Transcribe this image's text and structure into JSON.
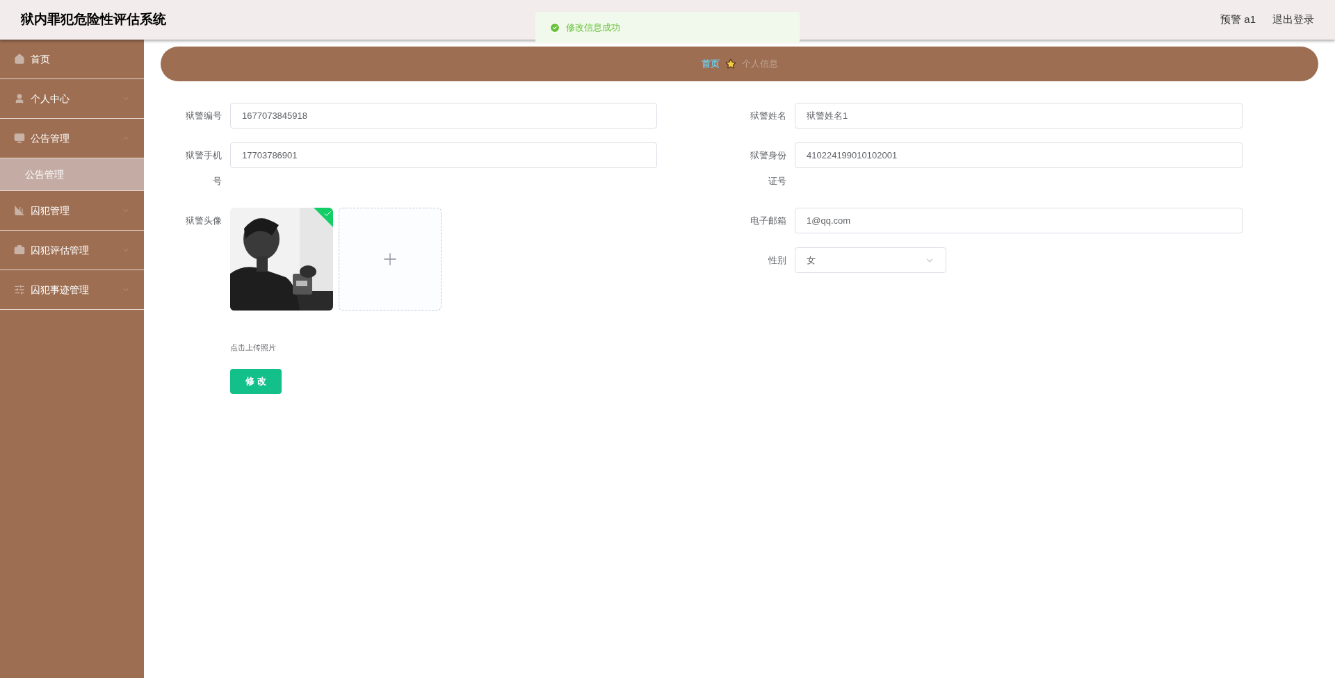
{
  "header": {
    "title": "狱内罪犯危险性评估系统",
    "user": "预警 a1",
    "logout": "退出登录"
  },
  "toast": {
    "message": "修改信息成功"
  },
  "sidebar": {
    "items": [
      {
        "label": "首页",
        "expandable": false
      },
      {
        "label": "个人中心",
        "expandable": true,
        "expanded": false
      },
      {
        "label": "公告管理",
        "expandable": true,
        "expanded": true,
        "children": [
          {
            "label": "公告管理",
            "selected": true
          }
        ]
      },
      {
        "label": "囚犯管理",
        "expandable": true,
        "expanded": false
      },
      {
        "label": "囚犯评估管理",
        "expandable": true,
        "expanded": false
      },
      {
        "label": "囚犯事迹管理",
        "expandable": true,
        "expanded": false
      }
    ]
  },
  "breadcrumb": {
    "home": "首页",
    "current": "个人信息"
  },
  "form": {
    "left": [
      {
        "kind": "input",
        "label": "狱警编号",
        "value": "1677073845918"
      },
      {
        "kind": "input",
        "label": "狱警手机号",
        "value": "17703786901"
      },
      {
        "kind": "upload",
        "label": "狱警头像",
        "uploaded": true,
        "hint": "点击上传照片"
      }
    ],
    "right": [
      {
        "kind": "input",
        "label": "狱警姓名",
        "value": "狱警姓名1"
      },
      {
        "kind": "input",
        "label": "狱警身份证号",
        "value": "410224199010102001"
      },
      {
        "kind": "input",
        "label": "电子邮箱",
        "value": "1@qq.com"
      },
      {
        "kind": "select",
        "label": "性别",
        "value": "女"
      }
    ],
    "submit": "修 改"
  }
}
